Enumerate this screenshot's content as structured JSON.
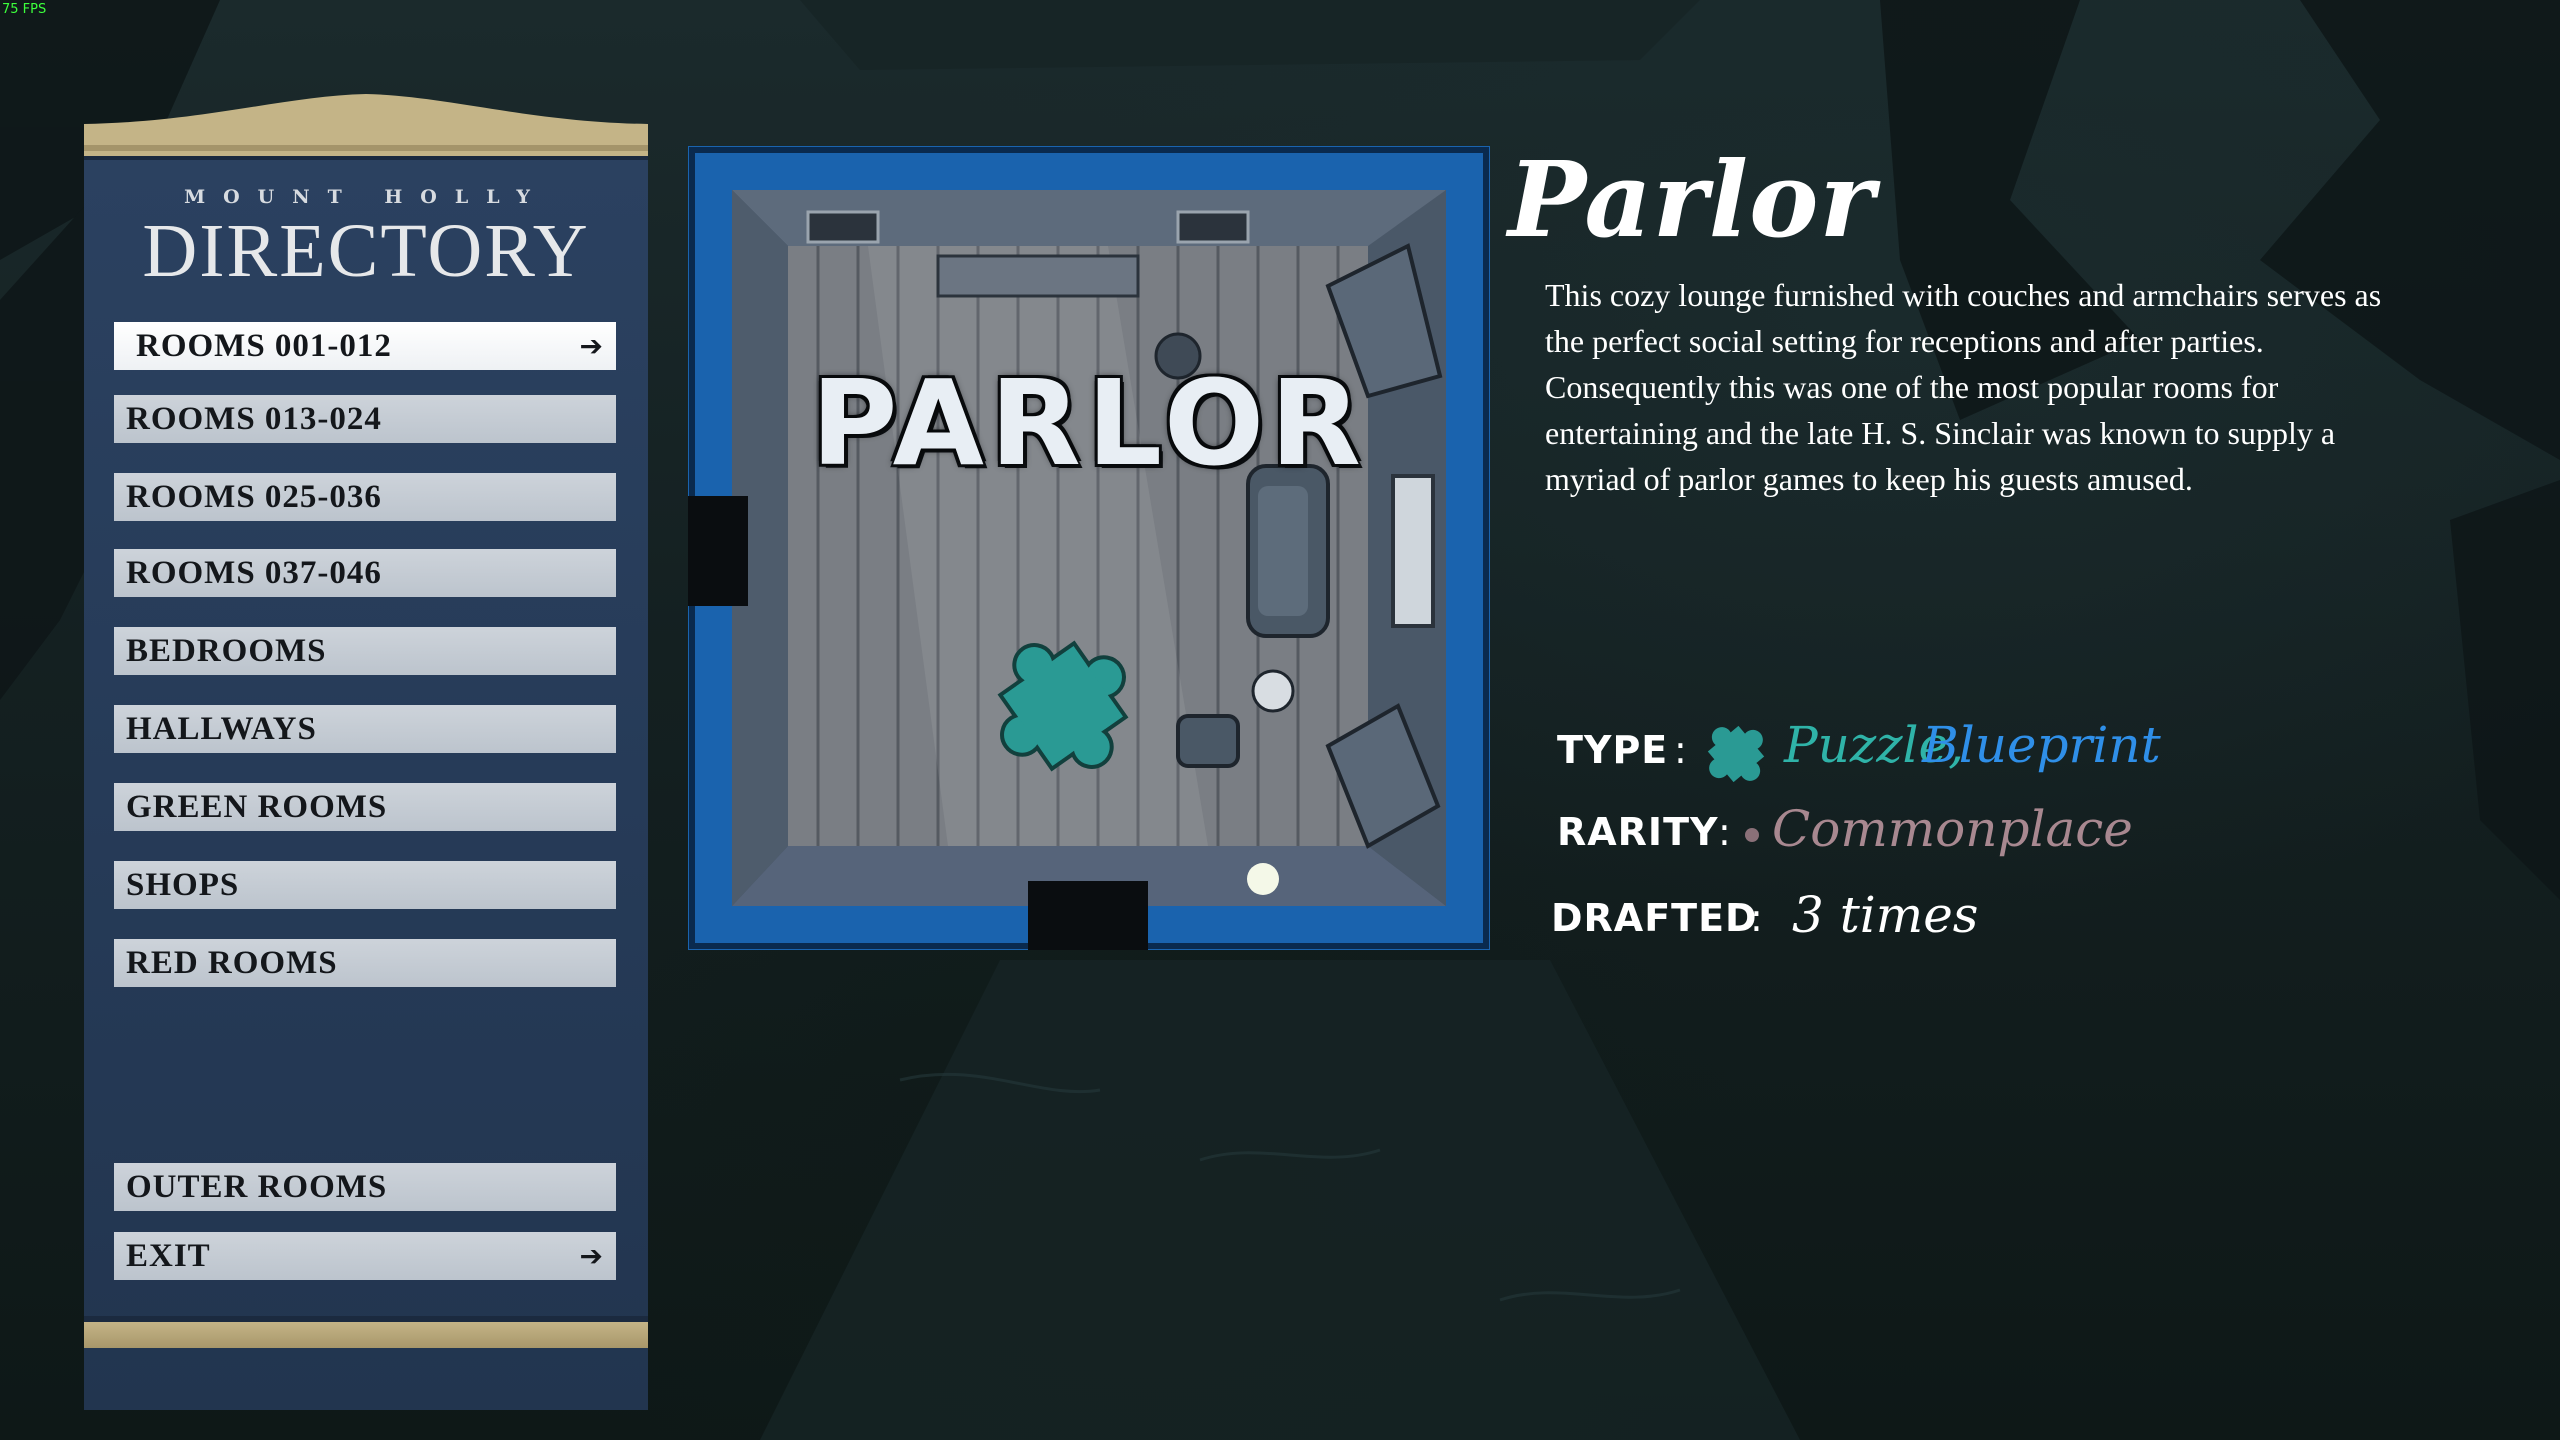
{
  "hud": {
    "fps": "75 FPS"
  },
  "directory": {
    "subtitle": "MOUNT HOLLY",
    "title": "DIRECTORY",
    "items": [
      {
        "label": "ROOMS 001-012",
        "active": true
      },
      {
        "label": "ROOMS 013-024"
      },
      {
        "label": "ROOMS 025-036"
      },
      {
        "label": "ROOMS 037-046"
      },
      {
        "label": "BEDROOMS"
      },
      {
        "label": "HALLWAYS"
      },
      {
        "label": "GREEN ROOMS"
      },
      {
        "label": "SHOPS"
      },
      {
        "label": "RED ROOMS"
      },
      {
        "label": "OUTER ROOMS"
      },
      {
        "label": "EXIT"
      }
    ]
  },
  "room": {
    "image_label": "PARLOR",
    "name": "Parlor",
    "description": "This cozy lounge furnished with couches and armchairs serves as the perfect social setting for receptions and after parties. Consequently this was one of the most popular rooms for entertaining and the late H. S. Sinclair was known to supply a myriad of parlor games to keep his guests amused.",
    "stats": {
      "type_label": "TYPE",
      "type_value_1": "Puzzle,",
      "type_value_2": "Blueprint",
      "rarity_label": "RARITY",
      "rarity_value": "Commonplace",
      "drafted_label": "DRAFTED",
      "drafted_value": "3 times",
      "colon": ":"
    }
  },
  "colors": {
    "panel_blue": "#263b58",
    "panel_gold": "#c4b487",
    "room_border_blue": "#1a63ae",
    "puzzle_teal": "#2a9a94",
    "type_puzzle": "#2fb3a8",
    "type_blueprint": "#2f8fe8",
    "rarity": "#a88890"
  },
  "icons": {
    "type_icon": "puzzle-piece-icon",
    "menu_arrow": "arrow-right-icon"
  }
}
